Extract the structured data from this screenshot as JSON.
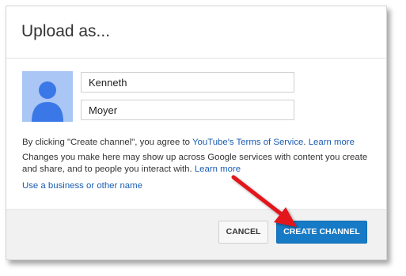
{
  "dialog": {
    "title": "Upload as..."
  },
  "form": {
    "first_name": "Kenneth",
    "last_name": "Moyer"
  },
  "terms": {
    "prefix": "By clicking \"Create channel\", you agree to ",
    "tos_link": "YouTube's Terms of Service",
    "separator": ". ",
    "learn_more_1": "Learn more",
    "changes_text": "Changes you make here may show up across Google services with content you create and share, and to people you interact with. ",
    "learn_more_2": "Learn more",
    "business_link": "Use a business or other name"
  },
  "buttons": {
    "cancel": "CANCEL",
    "create": "CREATE CHANNEL"
  },
  "icons": {
    "avatar": "default-avatar-icon",
    "annotation": "red-arrow-icon"
  },
  "colors": {
    "primary_button": "#167ac6",
    "link": "#1a5cb3",
    "avatar_bg": "#a9c6f5",
    "avatar_figure": "#3b78e7",
    "arrow": "#e3141b"
  }
}
